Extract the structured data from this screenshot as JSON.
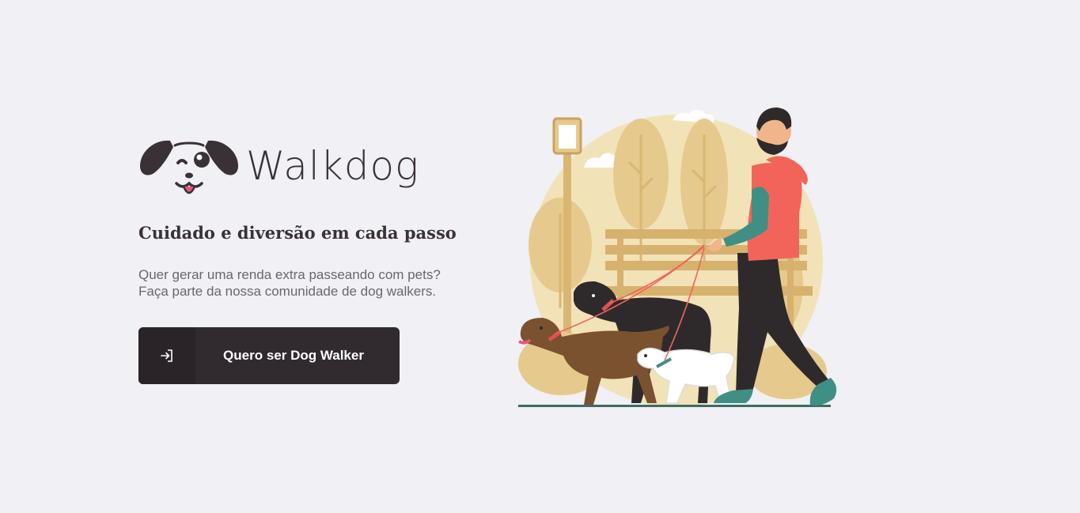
{
  "brand": {
    "name": "Walkdog"
  },
  "hero": {
    "headline": "Cuidado e diversão em cada passo",
    "subtitle_line1": "Quer gerar uma renda extra passeando com pets?",
    "subtitle_line2": "Faça parte da nossa comunidade de dog walkers."
  },
  "cta": {
    "label": "Quero ser Dog Walker",
    "icon": "sign-in-icon"
  },
  "colors": {
    "background": "#f0f0f5",
    "button": "#312a2e",
    "button_icon_bg": "#2a2428",
    "text_dark": "#3a3136",
    "text_muted": "#6b6570",
    "accent_red": "#f2645a"
  }
}
